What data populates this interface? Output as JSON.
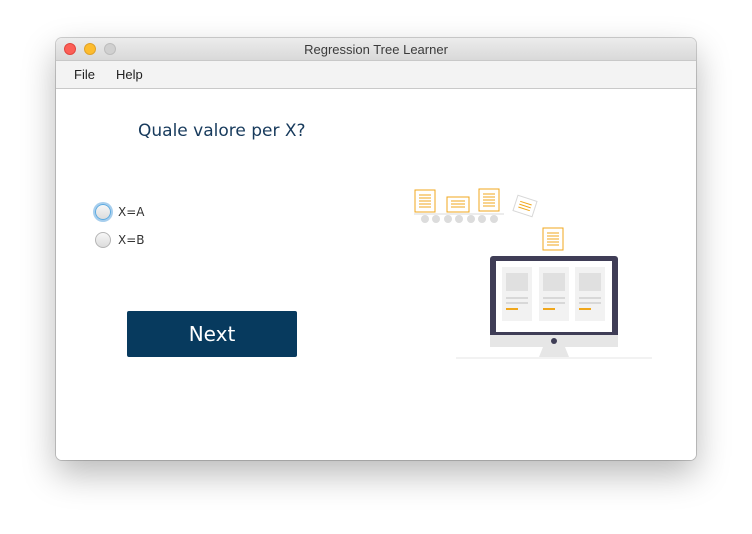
{
  "window": {
    "title": "Regression Tree Learner"
  },
  "menu": {
    "file": "File",
    "help": "Help"
  },
  "form": {
    "question": "Quale valore per X?",
    "options": [
      {
        "label": "X=A",
        "focused": true
      },
      {
        "label": "X=B",
        "focused": false
      }
    ],
    "next_label": "Next"
  },
  "colors": {
    "primary_button": "#073a5e",
    "question_text": "#173a5c",
    "accent_document": "#f0a71c"
  },
  "icons": {
    "illustration": "documents-to-computer-illustration"
  }
}
